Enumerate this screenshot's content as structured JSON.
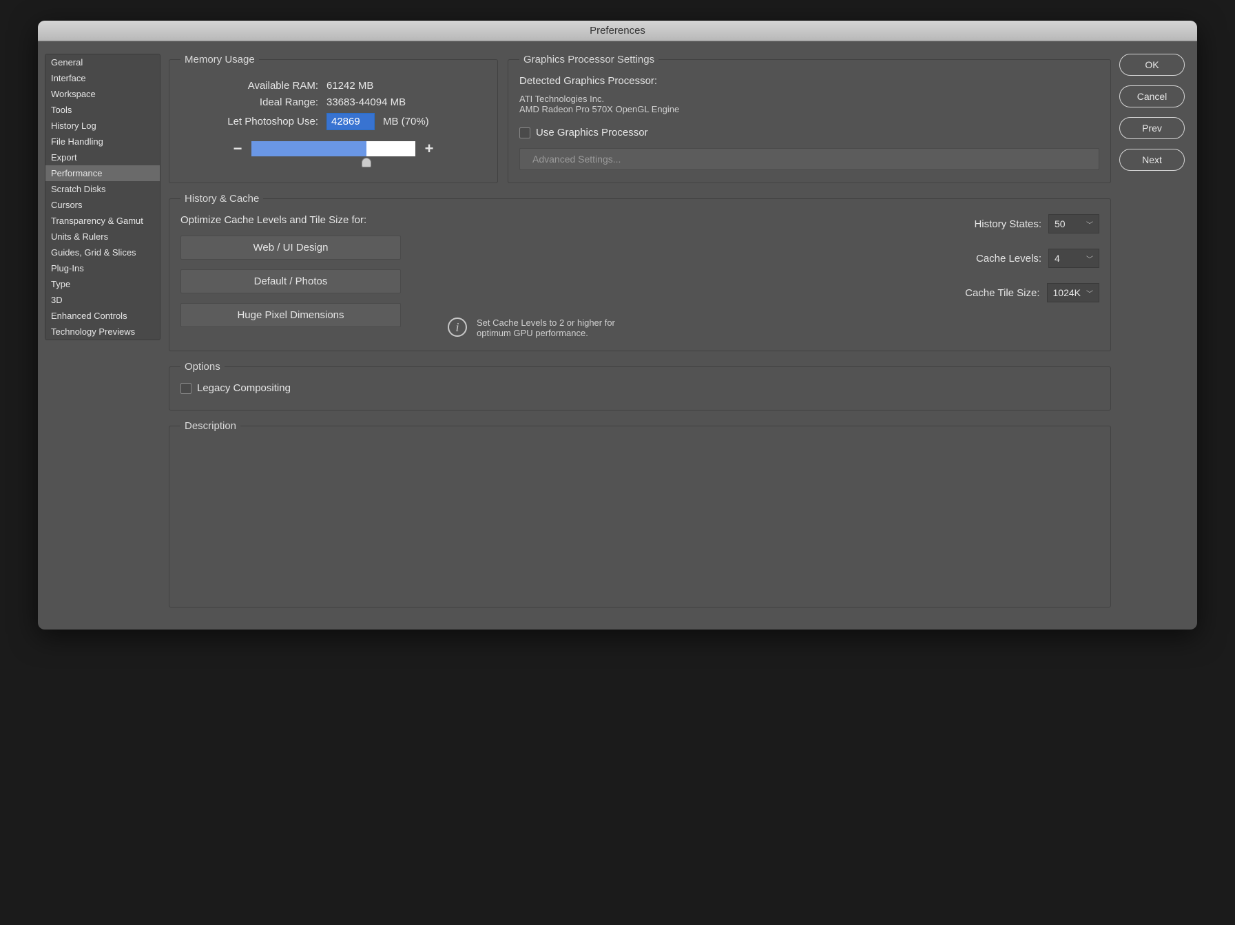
{
  "window": {
    "title": "Preferences"
  },
  "sidebar": {
    "items": [
      "General",
      "Interface",
      "Workspace",
      "Tools",
      "History Log",
      "File Handling",
      "Export",
      "Performance",
      "Scratch Disks",
      "Cursors",
      "Transparency & Gamut",
      "Units & Rulers",
      "Guides, Grid & Slices",
      "Plug-Ins",
      "Type",
      "3D",
      "Enhanced Controls",
      "Technology Previews"
    ],
    "selected_index": 7
  },
  "buttons": {
    "ok": "OK",
    "cancel": "Cancel",
    "prev": "Prev",
    "next": "Next"
  },
  "memory": {
    "legend": "Memory Usage",
    "available_label": "Available RAM:",
    "available_value": "61242 MB",
    "ideal_label": "Ideal Range:",
    "ideal_value": "33683-44094 MB",
    "let_use_label": "Let Photoshop Use:",
    "let_use_value": "42869",
    "let_use_suffix": "MB (70%)",
    "slider_percent": 70
  },
  "gpu": {
    "legend": "Graphics Processor Settings",
    "detected_label": "Detected Graphics Processor:",
    "vendor": "ATI Technologies Inc.",
    "device": "AMD Radeon Pro 570X OpenGL Engine",
    "use_gpu_label": "Use Graphics Processor",
    "advanced": "Advanced Settings..."
  },
  "history_cache": {
    "legend": "History & Cache",
    "optimize_label": "Optimize Cache Levels and Tile Size for:",
    "presets": [
      "Web / UI Design",
      "Default / Photos",
      "Huge Pixel Dimensions"
    ],
    "history_states_label": "History States:",
    "history_states_value": "50",
    "cache_levels_label": "Cache Levels:",
    "cache_levels_value": "4",
    "cache_tile_label": "Cache Tile Size:",
    "cache_tile_value": "1024K",
    "hint": "Set Cache Levels to 2 or higher for optimum GPU performance."
  },
  "options": {
    "legend": "Options",
    "legacy_label": "Legacy Compositing"
  },
  "description": {
    "legend": "Description"
  }
}
